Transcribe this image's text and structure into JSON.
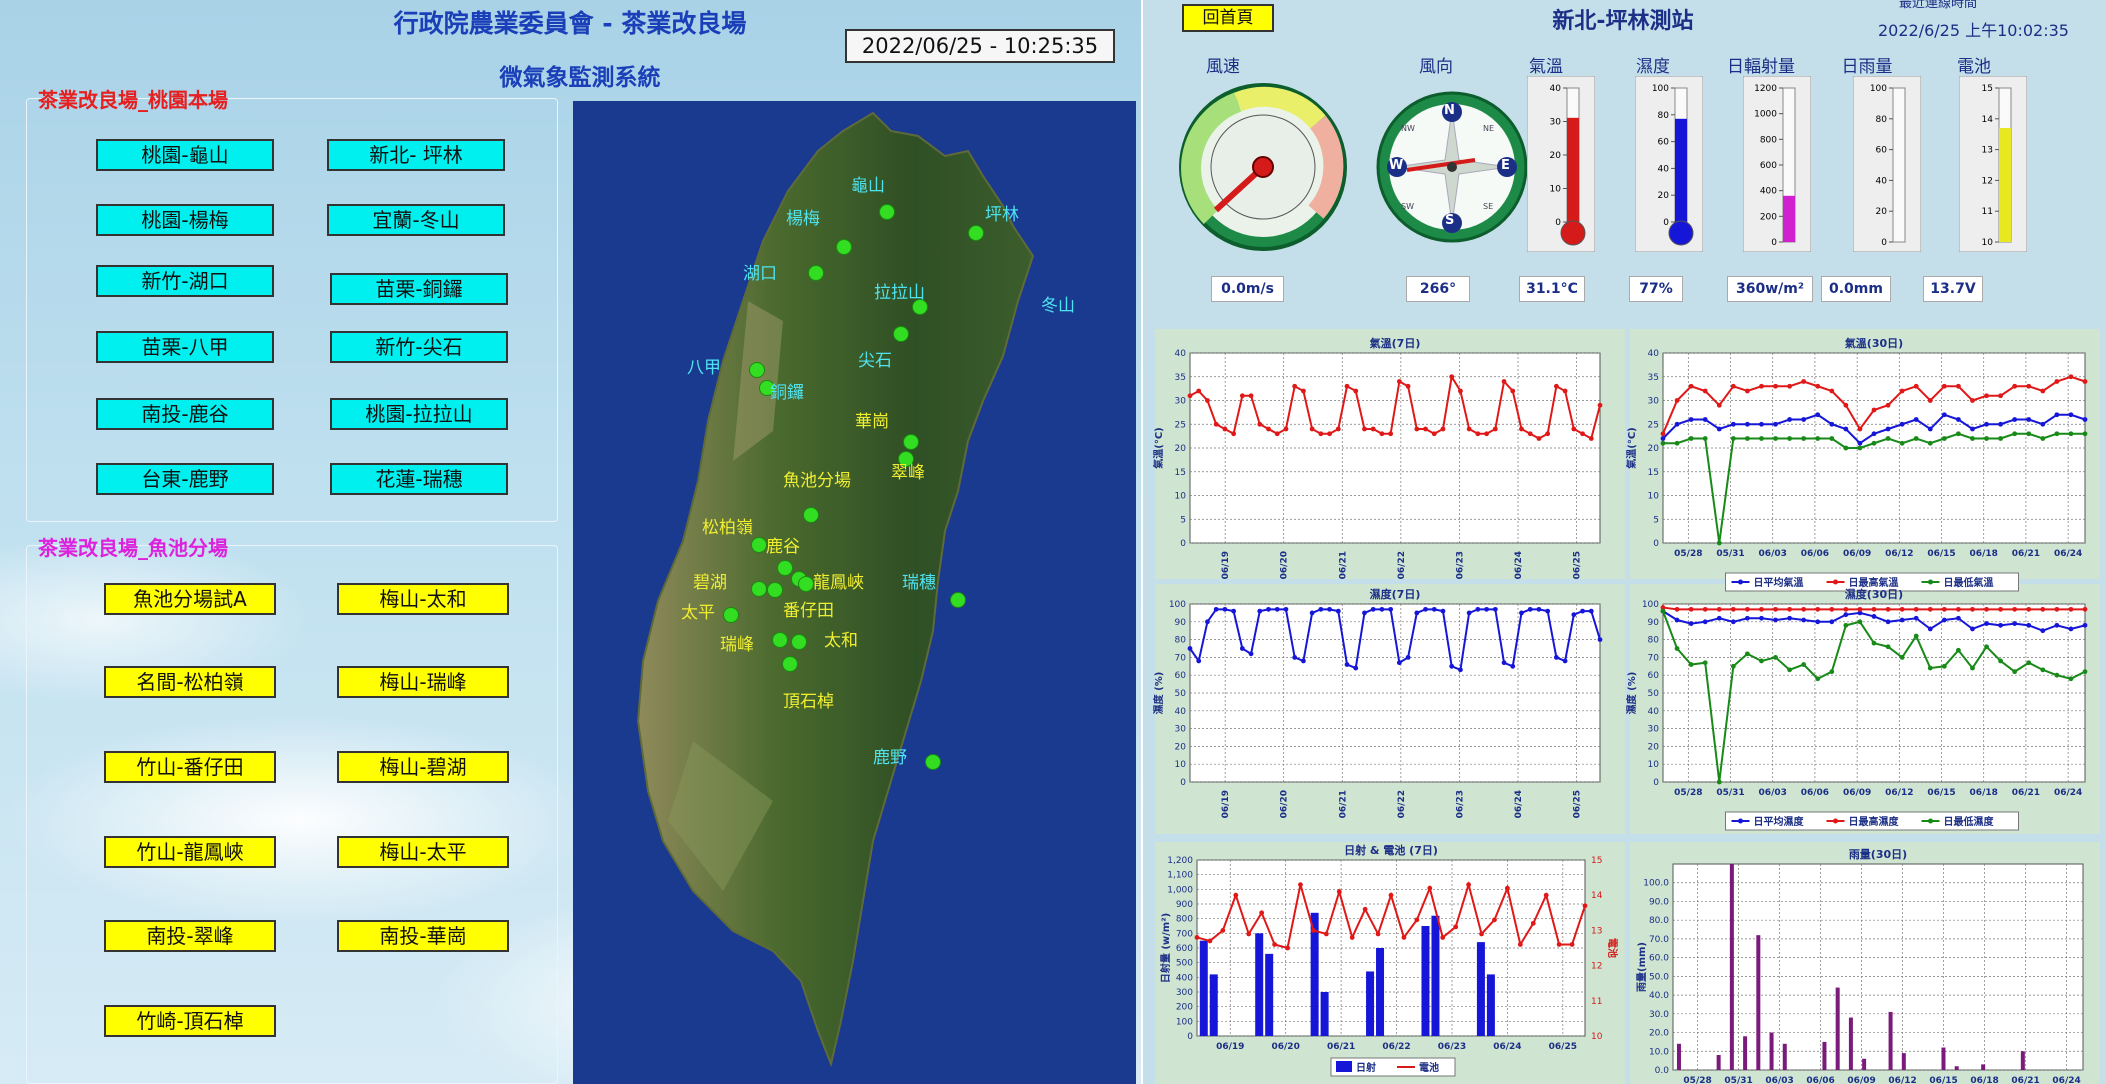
{
  "left": {
    "title": "行政院農業委員會 - 茶業改良場",
    "subtitle": "微氣象監測系統",
    "datetime": "2022/06/25 - 10:25:35",
    "group1": {
      "label": "茶業改良場_桃園本場",
      "buttons": [
        "桃園-龜山",
        "新北- 坪林",
        "桃園-楊梅",
        "宜蘭-冬山",
        "新竹-湖口",
        "苗栗-銅鑼",
        "苗栗-八甲",
        "新竹-尖石",
        "南投-鹿谷",
        "桃園-拉拉山",
        "台東-鹿野",
        "花蓮-瑞穗"
      ]
    },
    "group2": {
      "label": "茶業改良場_魚池分場",
      "buttons": [
        "魚池分場試A",
        "梅山-太和",
        "名間-松柏嶺",
        "梅山-瑞峰",
        "竹山-番仔田",
        "梅山-碧湖",
        "竹山-龍鳳峽",
        "梅山-太平",
        "南投-翠峰",
        "南投-華崗",
        "竹崎-頂石棹"
      ]
    },
    "map_labels": {
      "north": [
        "龜山",
        "楊梅",
        "坪林",
        "湖口",
        "拉拉山",
        "冬山",
        "尖石",
        "八甲",
        "銅鑼",
        "瑞穗",
        "鹿野"
      ],
      "south": [
        "華崗",
        "翠峰",
        "魚池分場",
        "松柏嶺",
        "鹿谷",
        "碧湖",
        "龍鳳峽",
        "太平",
        "番仔田",
        "瑞峰",
        "太和",
        "頂石棹"
      ]
    }
  },
  "right": {
    "home_button": "回首頁",
    "station_title": "新北-坪林測站",
    "last_update_label": "最近連線時間",
    "last_update": "2022/6/25 上午10:02:35",
    "gauges": [
      {
        "label": "風速",
        "value": "0.0m/s"
      },
      {
        "label": "風向",
        "value": "266°"
      },
      {
        "label": "氣溫",
        "value": "31.1°C"
      },
      {
        "label": "濕度",
        "value": "77%"
      },
      {
        "label": "日輻射量",
        "value": "360w/m²"
      },
      {
        "label": "日雨量",
        "value": "0.0mm"
      },
      {
        "label": "電池",
        "value": "13.7V"
      }
    ],
    "compass": {
      "n": "N",
      "s": "S",
      "e": "E",
      "w": "W",
      "ne": "NE",
      "nw": "NW",
      "se": "SE",
      "sw": "SW"
    },
    "colors": {
      "red": "#e01818",
      "blue": "#1616d8",
      "green": "#178a17",
      "magenta": "#d020d0",
      "yellow": "#e8e820"
    }
  },
  "chart_data": [
    {
      "type": "line",
      "title": "氣溫(7日)",
      "ylabel": "氣溫(°C)",
      "ylim": [
        0,
        40
      ],
      "yticks": [
        0,
        5,
        10,
        15,
        20,
        25,
        30,
        35,
        40
      ],
      "x": [
        "06/19",
        "06/20",
        "06/21",
        "06/22",
        "06/23",
        "06/24",
        "06/25"
      ],
      "series": [
        {
          "name": "",
          "color": "#e01818",
          "values": [
            31,
            32,
            30,
            25,
            24,
            23,
            31,
            31,
            25,
            24,
            23,
            24,
            33,
            32,
            24,
            23,
            23,
            24,
            33,
            32,
            24,
            24,
            23,
            23,
            34,
            33,
            24,
            24,
            23,
            24,
            35,
            32,
            24,
            23,
            23,
            24,
            34,
            32,
            24,
            23,
            22,
            23,
            33,
            32,
            24,
            23,
            22,
            29
          ]
        }
      ]
    },
    {
      "type": "line",
      "title": "氣溫(30日)",
      "ylabel": "氣溫(°C)",
      "ylim": [
        0,
        40
      ],
      "yticks": [
        0,
        5,
        10,
        15,
        20,
        25,
        30,
        35,
        40
      ],
      "x": [
        "05/28",
        "05/31",
        "06/03",
        "06/06",
        "06/09",
        "06/12",
        "06/15",
        "06/18",
        "06/21",
        "06/24"
      ],
      "series": [
        {
          "name": "日平均氣溫",
          "color": "#1616d8",
          "values": [
            22,
            25,
            26,
            26,
            24,
            25,
            25,
            25,
            25,
            26,
            26,
            27,
            25,
            24,
            21,
            23,
            24,
            25,
            26,
            24,
            27,
            26,
            24,
            25,
            25,
            26,
            26,
            25,
            27,
            27,
            26
          ]
        },
        {
          "name": "日最高氣溫",
          "color": "#e01818",
          "values": [
            23,
            30,
            33,
            32,
            29,
            33,
            32,
            33,
            33,
            33,
            34,
            33,
            32,
            29,
            24,
            28,
            29,
            32,
            33,
            30,
            33,
            33,
            30,
            31,
            31,
            33,
            33,
            32,
            34,
            35,
            34
          ]
        },
        {
          "name": "日最低氣溫",
          "color": "#178a17",
          "values": [
            21,
            21,
            22,
            22,
            0,
            22,
            22,
            22,
            22,
            22,
            22,
            22,
            22,
            20,
            20,
            21,
            22,
            21,
            22,
            21,
            22,
            23,
            22,
            22,
            22,
            23,
            23,
            22,
            23,
            23,
            23
          ]
        }
      ]
    },
    {
      "type": "line",
      "title": "濕度(7日)",
      "ylabel": "濕度 (%)",
      "ylim": [
        0,
        100
      ],
      "yticks": [
        0,
        10,
        20,
        30,
        40,
        50,
        60,
        70,
        80,
        90,
        100
      ],
      "x": [
        "06/19",
        "06/20",
        "06/21",
        "06/22",
        "06/23",
        "06/24",
        "06/25"
      ],
      "series": [
        {
          "name": "",
          "color": "#1616d8",
          "values": [
            75,
            68,
            90,
            97,
            97,
            96,
            75,
            72,
            96,
            97,
            97,
            97,
            70,
            68,
            95,
            97,
            97,
            96,
            66,
            64,
            95,
            97,
            97,
            97,
            67,
            70,
            95,
            97,
            97,
            96,
            65,
            63,
            95,
            97,
            97,
            97,
            67,
            65,
            95,
            97,
            97,
            96,
            70,
            68,
            94,
            96,
            96,
            80
          ]
        }
      ]
    },
    {
      "type": "line",
      "title": "濕度(30日)",
      "ylabel": "濕度 (%)",
      "ylim": [
        0,
        100
      ],
      "yticks": [
        0,
        10,
        20,
        30,
        40,
        50,
        60,
        70,
        80,
        90,
        100
      ],
      "x": [
        "05/28",
        "05/31",
        "06/03",
        "06/06",
        "06/09",
        "06/12",
        "06/15",
        "06/18",
        "06/21",
        "06/24"
      ],
      "series": [
        {
          "name": "日平均濕度",
          "color": "#1616d8",
          "values": [
            96,
            91,
            89,
            90,
            92,
            90,
            92,
            92,
            91,
            92,
            91,
            90,
            90,
            94,
            95,
            93,
            90,
            91,
            92,
            86,
            91,
            92,
            86,
            89,
            88,
            89,
            88,
            85,
            88,
            86,
            88
          ]
        },
        {
          "name": "日最高濕度",
          "color": "#e01818",
          "values": [
            98,
            97,
            97,
            97,
            97,
            97,
            97,
            97,
            97,
            97,
            97,
            97,
            97,
            97,
            97,
            97,
            97,
            97,
            97,
            97,
            97,
            97,
            97,
            97,
            97,
            97,
            97,
            97,
            97,
            97,
            97
          ]
        },
        {
          "name": "日最低濕度",
          "color": "#178a17",
          "values": [
            96,
            75,
            66,
            67,
            0,
            65,
            72,
            68,
            70,
            63,
            66,
            58,
            62,
            88,
            90,
            78,
            76,
            70,
            82,
            64,
            65,
            74,
            64,
            76,
            68,
            62,
            67,
            63,
            60,
            58,
            62
          ]
        }
      ]
    },
    {
      "type": "bar+line",
      "title": "日射 & 電池 (7日)",
      "ylabel": "日射量 (w/m²)",
      "y2label": "電池",
      "ylim": [
        0,
        1200
      ],
      "y2lim": [
        10,
        15
      ],
      "yticks": [
        0,
        100,
        200,
        300,
        400,
        500,
        600,
        700,
        800,
        900,
        1000,
        1100,
        1200
      ],
      "y2ticks": [
        10,
        11,
        12,
        13,
        14,
        15
      ],
      "x": [
        "06/19",
        "06/20",
        "06/21",
        "06/22",
        "06/23",
        "06/24",
        "06/25"
      ],
      "series": [
        {
          "name": "日射",
          "color": "#1616d8",
          "values": [
            650,
            420,
            700,
            560,
            840,
            300,
            440,
            600,
            750,
            820,
            640,
            420
          ]
        },
        {
          "name": "電池",
          "color": "#e01818",
          "values": [
            12.8,
            12.7,
            13.0,
            14.0,
            12.9,
            13.5,
            12.6,
            12.5,
            14.3,
            13.0,
            12.9,
            14.1,
            12.8,
            13.6,
            12.9,
            14.0,
            12.8,
            13.3,
            14.2,
            12.8,
            13.1,
            14.3,
            12.9,
            13.3,
            14.2,
            12.6,
            13.2,
            14.0,
            12.6,
            12.6,
            13.7
          ]
        }
      ]
    },
    {
      "type": "bar",
      "title": "雨量(30日)",
      "ylabel": "雨量(mm)",
      "ylim": [
        0,
        110
      ],
      "yticks": [
        0,
        10,
        20,
        30,
        40,
        50,
        60,
        70,
        80,
        90,
        100
      ],
      "x": [
        "05/28",
        "05/31",
        "06/03",
        "06/06",
        "06/09",
        "06/12",
        "06/15",
        "06/18",
        "06/21",
        "06/24"
      ],
      "series": [
        {
          "name": "雨量",
          "color": "#7a1a7a",
          "values": [
            14,
            0,
            0,
            8,
            110,
            18,
            72,
            20,
            14,
            0,
            0,
            15,
            44,
            28,
            6,
            0,
            31,
            9,
            0,
            0,
            12,
            2,
            0,
            3,
            0,
            0,
            10,
            0,
            0,
            0,
            0
          ]
        }
      ]
    }
  ]
}
